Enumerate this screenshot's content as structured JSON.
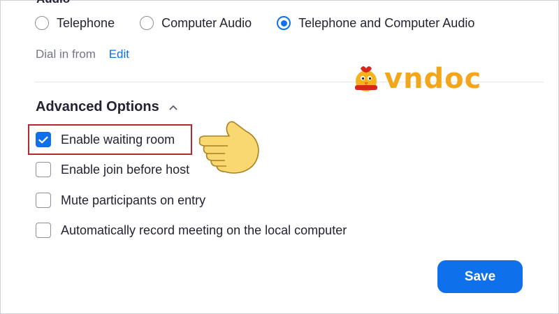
{
  "audio": {
    "heading": "Audio",
    "options": [
      {
        "label": "Telephone",
        "selected": false
      },
      {
        "label": "Computer Audio",
        "selected": false
      },
      {
        "label": "Telephone and Computer Audio",
        "selected": true
      }
    ],
    "dial_in_label": "Dial in from",
    "edit_label": "Edit"
  },
  "advanced": {
    "heading": "Advanced Options",
    "options": [
      {
        "label": "Enable waiting room",
        "checked": true
      },
      {
        "label": "Enable join before host",
        "checked": false
      },
      {
        "label": "Mute participants on entry",
        "checked": false
      },
      {
        "label": "Automatically record meeting on the local computer",
        "checked": false
      }
    ]
  },
  "save_label": "Save",
  "logo": {
    "text": "vndoc"
  },
  "colors": {
    "accent": "#0e71eb",
    "highlight_border": "#b5282e",
    "logo": "#f3a51c"
  }
}
